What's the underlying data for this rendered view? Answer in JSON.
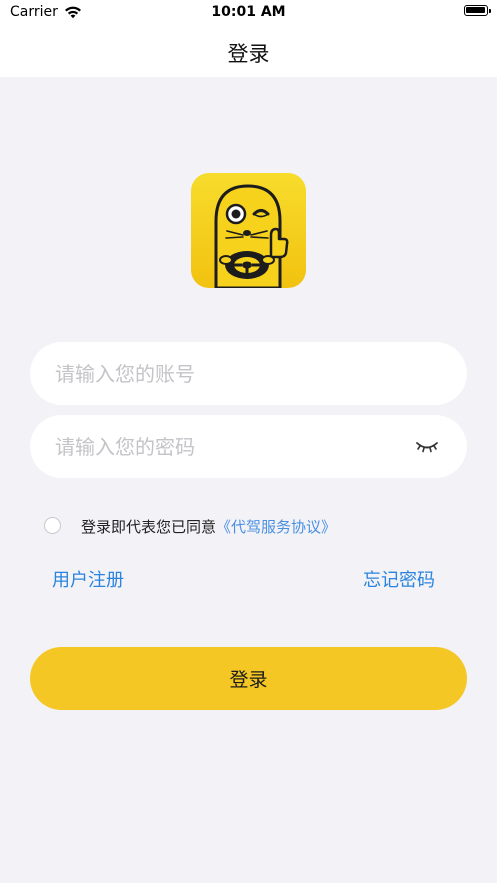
{
  "status_bar": {
    "carrier": "Carrier",
    "time": "10:01 AM"
  },
  "nav": {
    "title": "登录"
  },
  "form": {
    "account_placeholder": "请输入您的账号",
    "password_placeholder": "请输入您的密码",
    "agreement_text": "登录即代表您已同意",
    "agreement_link": "《代驾服务协议》",
    "register_link": "用户注册",
    "forgot_link": "忘记密码",
    "login_button": "登录"
  },
  "colors": {
    "accent_yellow": "#f5c724",
    "link_blue": "#2a84dd",
    "background": "#f2f2f7"
  },
  "icons": {
    "wifi": "wifi-icon",
    "battery": "battery-icon",
    "logo": "app-logo",
    "eye": "eye-closed-icon",
    "checkbox": "radio-unchecked-icon"
  }
}
